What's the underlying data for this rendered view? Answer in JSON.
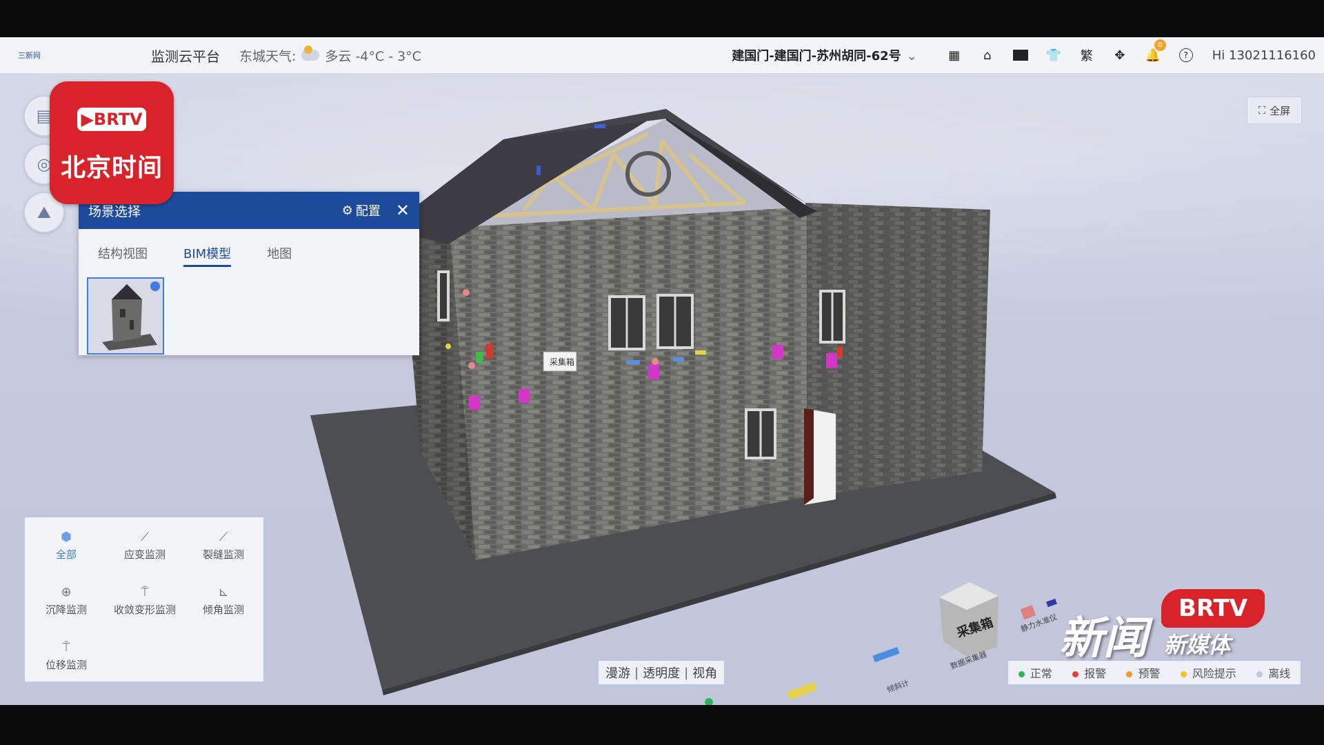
{
  "topbar": {
    "logo_text": "三新网",
    "platform_title": "监测云平台",
    "weather_label": "东城天气:",
    "weather_value": "多云 -4°C - 3°C",
    "address": "建国门-建国门-苏州胡同-62号",
    "notification_count": "0",
    "traditional_label": "繁",
    "help_label": "?",
    "user_greeting": "Hi 13021116160"
  },
  "brtv_logo": {
    "tag": "▶BRTV",
    "name": "北京时间"
  },
  "fullscreen_label": "全屏",
  "scene_panel": {
    "title": "场景选择",
    "config_label": "配置",
    "tabs": [
      "结构视图",
      "BIM模型",
      "地图"
    ],
    "active_tab": "BIM模型"
  },
  "building_label": "采集箱",
  "ground_labels": [
    "采集箱",
    "数据采集器",
    "倾斜计",
    "静力水准仪"
  ],
  "monitoring": {
    "items": [
      {
        "label": "全部",
        "icon": "cube-icon"
      },
      {
        "label": "应变监测",
        "icon": "strain-gauge-icon"
      },
      {
        "label": "裂缝监测",
        "icon": "crack-gauge-icon"
      },
      {
        "label": "沉降监测",
        "icon": "settlement-icon"
      },
      {
        "label": "收敛变形监测",
        "icon": "convergence-icon"
      },
      {
        "label": "倾角监测",
        "icon": "inclination-icon"
      },
      {
        "label": "位移监测",
        "icon": "displacement-icon"
      }
    ]
  },
  "view_controls": [
    "漫游",
    "透明度",
    "视角"
  ],
  "legend": [
    {
      "label": "正常",
      "color": "#2fb35a"
    },
    {
      "label": "报警",
      "color": "#e0433f"
    },
    {
      "label": "预警",
      "color": "#f29b2c"
    },
    {
      "label": "风险提示",
      "color": "#f2c12c"
    },
    {
      "label": "离线",
      "color": "#c8c8c8"
    }
  ],
  "news_watermark": {
    "brand": "BRTV",
    "main": "新闻",
    "sub": "新媒体"
  }
}
